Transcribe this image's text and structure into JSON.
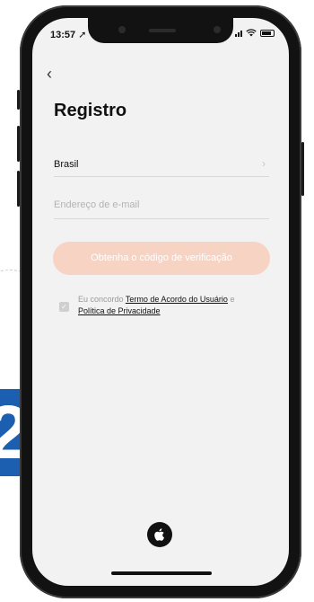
{
  "status_bar": {
    "time": "13:57",
    "location_glyph": "➚"
  },
  "header": {
    "back_glyph": "‹",
    "title": "Registro"
  },
  "form": {
    "country_value": "Brasil",
    "country_chevron": "›",
    "email_placeholder": "Endereço de e-mail"
  },
  "verify_button": {
    "label": "Obtenha o código de verificação"
  },
  "agreement": {
    "check_glyph": "✓",
    "prefix": "Eu concordo ",
    "terms_link": "Termo de Acordo do Usuário",
    "joiner": " e",
    "privacy_link": "Política de Privacidade"
  },
  "icons": {
    "back": "chevron-left-icon",
    "country_chevron": "chevron-right-icon",
    "checkbox": "check-icon",
    "apple": "apple-icon",
    "wifi": "wifi-icon",
    "signal": "signal-icon",
    "battery": "battery-icon"
  },
  "overlay": {
    "step_number": "2"
  },
  "colors": {
    "button_bg": "#f7d3c4",
    "step_badge": "#1c5fb0",
    "screen_bg": "#f2f2f2"
  }
}
